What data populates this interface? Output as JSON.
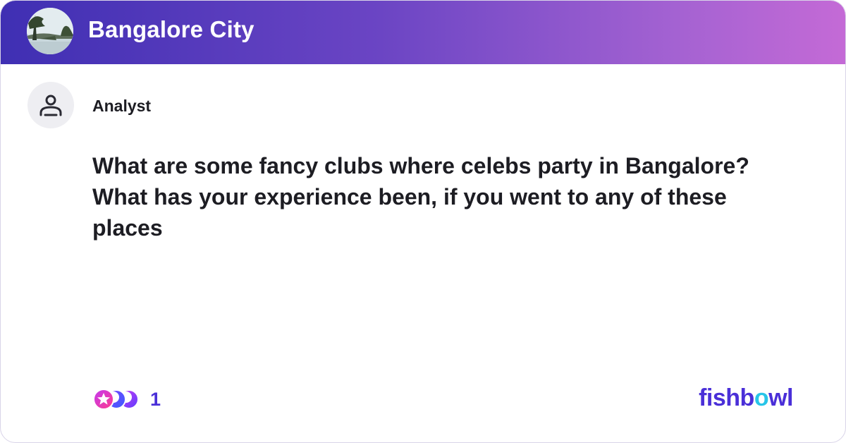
{
  "bowl": {
    "name": "Bangalore City",
    "avatar_icon": "lake-photo-icon"
  },
  "post": {
    "author": "Analyst",
    "author_icon": "user-silhouette-icon",
    "question": "What are some fancy clubs where celebs party in Bangalore? What has your experience been, if you went to any of these places",
    "reaction_count": "1",
    "reaction_icons": [
      "star-reaction-icon",
      "moon-reaction-icon",
      "moon-reaction-icon"
    ]
  },
  "brand": {
    "name": "fishbowl",
    "pre": "fishb",
    "accent": "o",
    "post": "wl",
    "colors": {
      "primary": "#4a2fd8",
      "accent": "#28c5e8"
    }
  },
  "theme": {
    "header_gradient": [
      "#3f2fb3",
      "#c46ad6"
    ]
  }
}
